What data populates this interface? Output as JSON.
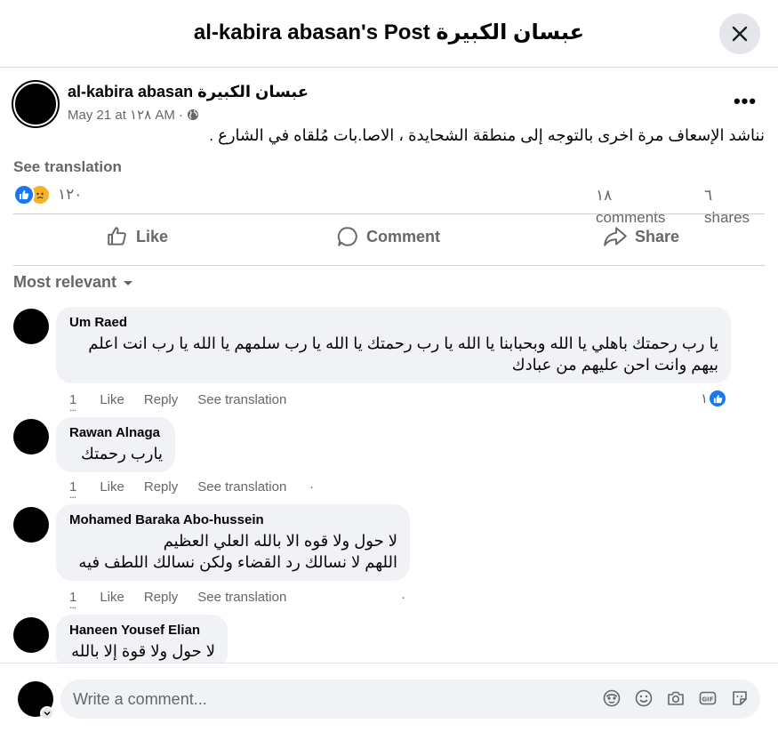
{
  "header": {
    "title": "al-kabira abasan's Post عبسان الكبيرة"
  },
  "post": {
    "author": "al-kabira abasan عبسان الكبيرة",
    "meta": "May 21 at ١٢٨ AM ·",
    "text": "نناشد الإسعاف مرة اخرى بالتوجه إلى منطقة الشحايدة ، الاصا.بات مُلقاه في الشارع .",
    "see_translation": "See translation",
    "reaction_count": "١٢٠",
    "comments_count": "١٨",
    "comments_label": "comments",
    "shares_count": "٦",
    "shares_label": "shares"
  },
  "actions": {
    "like": "Like",
    "comment": "Comment",
    "share": "Share"
  },
  "sort": {
    "label": "Most relevant"
  },
  "comments": [
    {
      "name": "Um Raed",
      "text": "يا رب رحمتك باهلي يا الله وبحبابنا يا الله يا رب رحمتك يا الله يا رب سلمهم يا الله يا رب انت اعلم بيهم وانت احن عليهم من عبادك",
      "time": "1",
      "like": "Like",
      "reply": "Reply",
      "translate": "See translation",
      "likes": "١"
    },
    {
      "name": "Rawan Alnaga",
      "text": "يارب رحمتك",
      "time": "1",
      "like": "Like",
      "reply": "Reply",
      "translate": "See translation"
    },
    {
      "name": "Mohamed Baraka Abo-hussein",
      "text": "لا حول ولا قوه الا بالله العلي العظيم\nاللهم لا نسالك رد القضاء ولكن نسالك اللطف فيه",
      "time": "1",
      "like": "Like",
      "reply": "Reply",
      "translate": "See translation"
    },
    {
      "name": "Haneen Yousef Elian",
      "text": "لا حول ولا قوة إلا بالله"
    }
  ],
  "composer": {
    "placeholder": "Write a comment..."
  }
}
